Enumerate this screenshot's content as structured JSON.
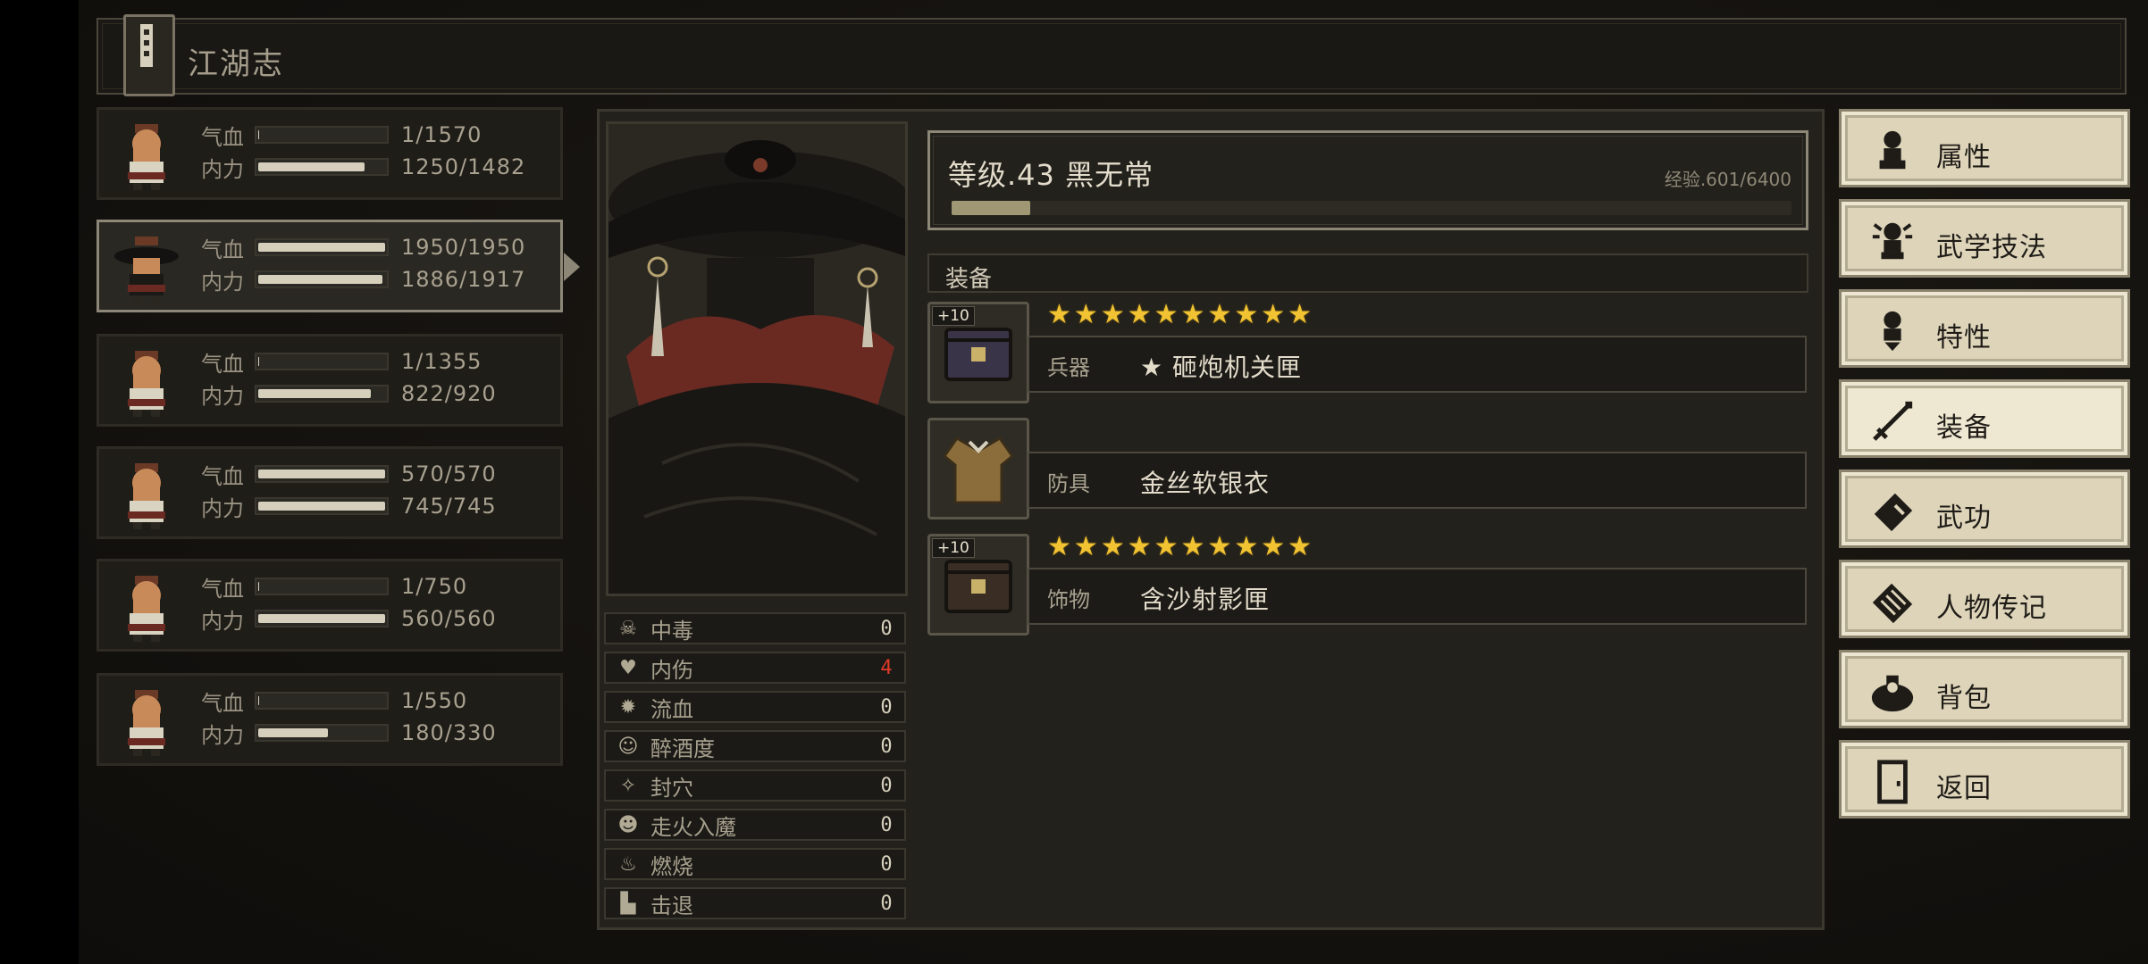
{
  "title": "江湖志",
  "party": [
    {
      "hp_label": "气血",
      "hp": "1/1570",
      "hp_frac": 0.0006,
      "mp_label": "内力",
      "mp": "1250/1482",
      "mp_frac": 0.84,
      "selected": false
    },
    {
      "hp_label": "气血",
      "hp": "1950/1950",
      "hp_frac": 1.0,
      "mp_label": "内力",
      "mp": "1886/1917",
      "mp_frac": 0.98,
      "selected": true
    },
    {
      "hp_label": "气血",
      "hp": "1/1355",
      "hp_frac": 0.0007,
      "mp_label": "内力",
      "mp": "822/920",
      "mp_frac": 0.89,
      "selected": false
    },
    {
      "hp_label": "气血",
      "hp": "570/570",
      "hp_frac": 1.0,
      "mp_label": "内力",
      "mp": "745/745",
      "mp_frac": 1.0,
      "selected": false
    },
    {
      "hp_label": "气血",
      "hp": "1/750",
      "hp_frac": 0.0013,
      "mp_label": "内力",
      "mp": "560/560",
      "mp_frac": 1.0,
      "selected": false
    },
    {
      "hp_label": "气血",
      "hp": "1/550",
      "hp_frac": 0.0018,
      "mp_label": "内力",
      "mp": "180/330",
      "mp_frac": 0.55,
      "selected": false
    }
  ],
  "status": [
    {
      "icon": "skull-icon",
      "label": "中毒",
      "value": "0",
      "alert": false
    },
    {
      "icon": "broken-heart-icon",
      "label": "内伤",
      "value": "4",
      "alert": true
    },
    {
      "icon": "blood-drop-icon",
      "label": "流血",
      "value": "0",
      "alert": false
    },
    {
      "icon": "drunk-face-icon",
      "label": "醉酒度",
      "value": "0",
      "alert": false
    },
    {
      "icon": "acupoint-icon",
      "label": "封穴",
      "value": "0",
      "alert": false
    },
    {
      "icon": "demon-face-icon",
      "label": "走火入魔",
      "value": "0",
      "alert": false
    },
    {
      "icon": "fire-icon",
      "label": "燃烧",
      "value": "0",
      "alert": false
    },
    {
      "icon": "boot-icon",
      "label": "击退",
      "value": "0",
      "alert": false
    }
  ],
  "level": {
    "title": "等级.43 黑无常",
    "exp": "经验.601/6400",
    "exp_frac": 0.094
  },
  "equipment": {
    "header": "装备",
    "slots": [
      {
        "type": "兵器",
        "name": "★ 砸炮机关匣",
        "plus": "+10",
        "stars": 10
      },
      {
        "type": "防具",
        "name": "金丝软银衣",
        "plus": "",
        "stars": 0
      },
      {
        "type": "饰物",
        "name": "含沙射影匣",
        "plus": "+10",
        "stars": 10
      }
    ]
  },
  "menu": [
    {
      "label": "属性",
      "icon": "character-icon",
      "active": false
    },
    {
      "label": "武学技法",
      "icon": "martial-skill-icon",
      "active": false
    },
    {
      "label": "特性",
      "icon": "trait-icon",
      "active": false
    },
    {
      "label": "装备",
      "icon": "sword-icon",
      "active": true
    },
    {
      "label": "武功",
      "icon": "manual-book-icon",
      "active": false
    },
    {
      "label": "人物传记",
      "icon": "scroll-icon",
      "active": false
    },
    {
      "label": "背包",
      "icon": "bag-icon",
      "active": false
    },
    {
      "label": "返回",
      "icon": "door-icon",
      "active": false
    }
  ],
  "colors": {
    "accent": "#d6cfbc",
    "alert": "#e23a2a",
    "star": "#f1c232",
    "menu_bg": "#ddd4b9"
  }
}
